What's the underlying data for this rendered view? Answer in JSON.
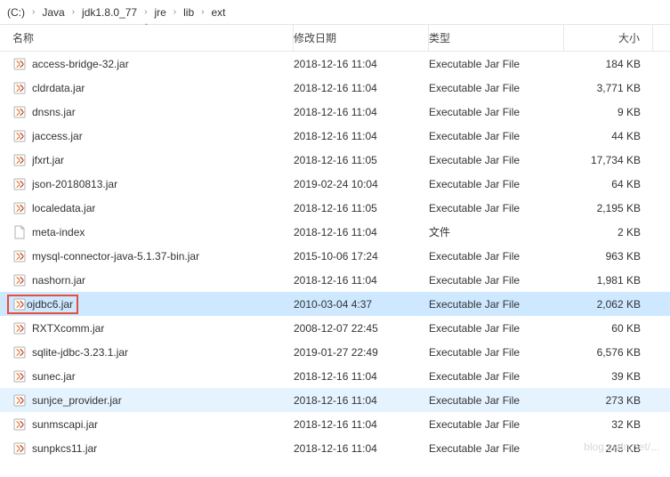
{
  "breadcrumb": {
    "items": [
      "(C:)",
      "Java",
      "jdk1.8.0_77",
      "jre",
      "lib",
      "ext"
    ]
  },
  "columns": {
    "name": "名称",
    "date": "修改日期",
    "type": "类型",
    "size": "大小"
  },
  "files": [
    {
      "name": "access-bridge-32.jar",
      "date": "2018-12-16 11:04",
      "type": "Executable Jar File",
      "size": "184 KB",
      "icon": "jar"
    },
    {
      "name": "cldrdata.jar",
      "date": "2018-12-16 11:04",
      "type": "Executable Jar File",
      "size": "3,771 KB",
      "icon": "jar"
    },
    {
      "name": "dnsns.jar",
      "date": "2018-12-16 11:04",
      "type": "Executable Jar File",
      "size": "9 KB",
      "icon": "jar"
    },
    {
      "name": "jaccess.jar",
      "date": "2018-12-16 11:04",
      "type": "Executable Jar File",
      "size": "44 KB",
      "icon": "jar"
    },
    {
      "name": "jfxrt.jar",
      "date": "2018-12-16 11:05",
      "type": "Executable Jar File",
      "size": "17,734 KB",
      "icon": "jar"
    },
    {
      "name": "json-20180813.jar",
      "date": "2019-02-24 10:04",
      "type": "Executable Jar File",
      "size": "64 KB",
      "icon": "jar"
    },
    {
      "name": "localedata.jar",
      "date": "2018-12-16 11:05",
      "type": "Executable Jar File",
      "size": "2,195 KB",
      "icon": "jar"
    },
    {
      "name": "meta-index",
      "date": "2018-12-16 11:04",
      "type": "文件",
      "size": "2 KB",
      "icon": "file"
    },
    {
      "name": "mysql-connector-java-5.1.37-bin.jar",
      "date": "2015-10-06 17:24",
      "type": "Executable Jar File",
      "size": "963 KB",
      "icon": "jar"
    },
    {
      "name": "nashorn.jar",
      "date": "2018-12-16 11:04",
      "type": "Executable Jar File",
      "size": "1,981 KB",
      "icon": "jar"
    },
    {
      "name": "ojdbc6.jar",
      "date": "2010-03-04 4:37",
      "type": "Executable Jar File",
      "size": "2,062 KB",
      "icon": "jar",
      "selected": true,
      "highlighted": true
    },
    {
      "name": "RXTXcomm.jar",
      "date": "2008-12-07 22:45",
      "type": "Executable Jar File",
      "size": "60 KB",
      "icon": "jar"
    },
    {
      "name": "sqlite-jdbc-3.23.1.jar",
      "date": "2019-01-27 22:49",
      "type": "Executable Jar File",
      "size": "6,576 KB",
      "icon": "jar"
    },
    {
      "name": "sunec.jar",
      "date": "2018-12-16 11:04",
      "type": "Executable Jar File",
      "size": "39 KB",
      "icon": "jar"
    },
    {
      "name": "sunjce_provider.jar",
      "date": "2018-12-16 11:04",
      "type": "Executable Jar File",
      "size": "273 KB",
      "icon": "jar",
      "hover": true
    },
    {
      "name": "sunmscapi.jar",
      "date": "2018-12-16 11:04",
      "type": "Executable Jar File",
      "size": "32 KB",
      "icon": "jar"
    },
    {
      "name": "sunpkcs11.jar",
      "date": "2018-12-16 11:04",
      "type": "Executable Jar File",
      "size": "245 KB",
      "icon": "jar"
    }
  ],
  "watermark": "blog.csdn.net/..."
}
